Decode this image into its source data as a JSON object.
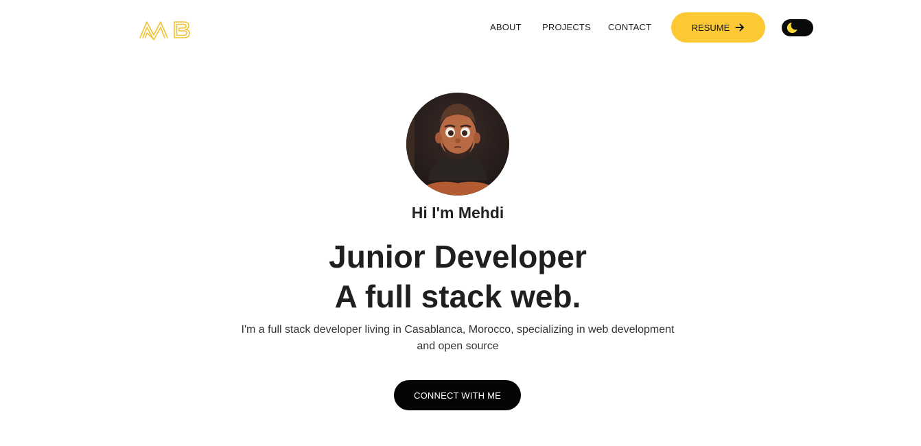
{
  "brand": {
    "logo_text": "MB",
    "accent_color": "#fcc934"
  },
  "nav": {
    "links": [
      "ABOUT",
      "PROJECTS",
      "CONTACT"
    ],
    "resume_label": "RESUME",
    "resume_icon": "arrow-right-icon",
    "theme_icon": "moon-icon"
  },
  "hero": {
    "avatar_icon": "profile-avatar",
    "greeting": "Hi I'm Mehdi",
    "headline_line1": "Junior Developer",
    "headline_line2": "A full stack web.",
    "description_line1": "I'm a full stack developer living in Casablanca, Morocco, specializing in web development",
    "description_line2": "and open source",
    "cta_label": "CONNECT WITH ME"
  }
}
